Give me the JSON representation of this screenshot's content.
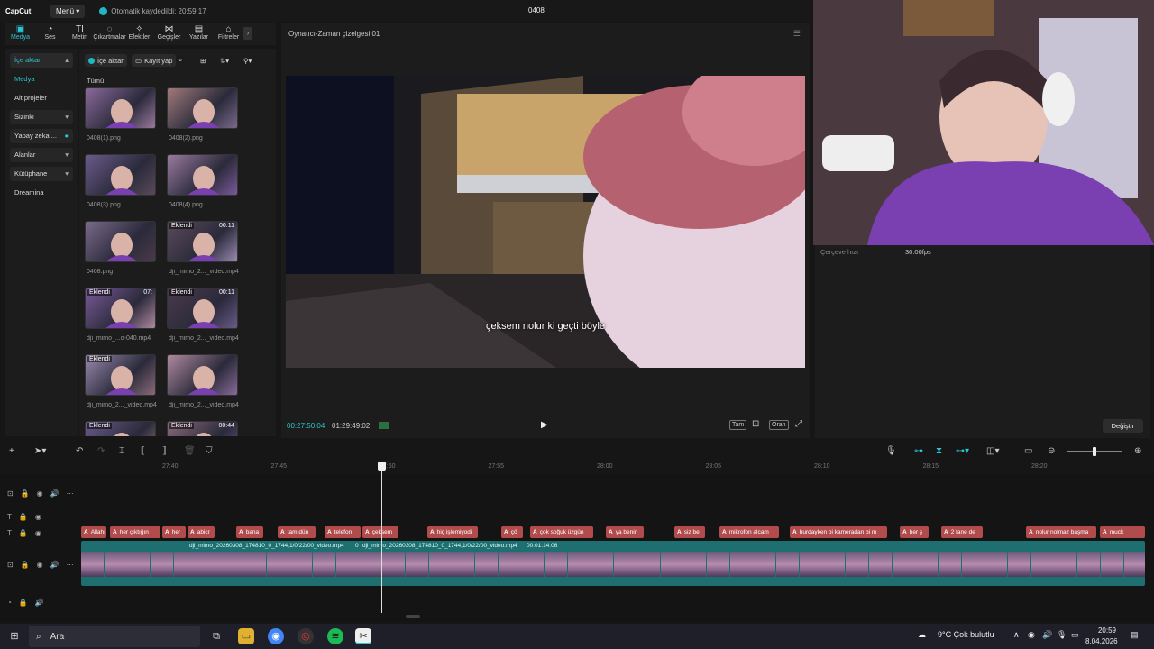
{
  "app": {
    "logo": "CapCut",
    "menu": "Menü",
    "autosave": "Otomatik kaydedildi: 20:59:17",
    "project": "0408"
  },
  "tabs": [
    {
      "label": "Medya",
      "icon": "media-icon",
      "glyph": "▣"
    },
    {
      "label": "Ses",
      "icon": "audio-icon",
      "glyph": "◔"
    },
    {
      "label": "Metin",
      "icon": "text-icon",
      "glyph": "TI"
    },
    {
      "label": "Çıkartmalar",
      "icon": "sticker-icon",
      "glyph": "◌"
    },
    {
      "label": "Efektler",
      "icon": "effects-icon",
      "glyph": "✧"
    },
    {
      "label": "Geçişler",
      "icon": "transitions-icon",
      "glyph": "⋈"
    },
    {
      "label": "Yazılar",
      "icon": "captions-icon",
      "glyph": "▤"
    },
    {
      "label": "Filtreler",
      "icon": "filters-icon",
      "glyph": "⌂"
    }
  ],
  "nav": [
    {
      "label": "İçe aktar",
      "arrow": "▴"
    },
    {
      "label": "Medya",
      "arrow": ""
    },
    {
      "label": "Alt projeler",
      "arrow": ""
    },
    {
      "label": "Sizinki",
      "arrow": "▾"
    },
    {
      "label": "Yapay zeka ...",
      "arrow": "●"
    },
    {
      "label": "Alanlar",
      "arrow": "▾"
    },
    {
      "label": "Kütüphane",
      "arrow": "▾"
    },
    {
      "label": "Dreamina",
      "arrow": ""
    }
  ],
  "media": {
    "import": "İçe aktar",
    "record": "Kayıt yap",
    "all": "Tümü",
    "items": [
      {
        "name": "0408(1).png",
        "badge": "",
        "dur": ""
      },
      {
        "name": "0408(2).png",
        "badge": "",
        "dur": ""
      },
      {
        "name": "0408(3).png",
        "badge": "",
        "dur": ""
      },
      {
        "name": "0408(4).png",
        "badge": "",
        "dur": ""
      },
      {
        "name": "0408.png",
        "badge": "",
        "dur": ""
      },
      {
        "name": "dji_mimo_2..._video.mp4",
        "badge": "Eklendi",
        "dur": "00:11"
      },
      {
        "name": "dji_mimo_...o-040.mp4",
        "badge": "Eklendi",
        "dur": "07:"
      },
      {
        "name": "dji_mimo_2..._video.mp4",
        "badge": "Eklendi",
        "dur": "00:11"
      },
      {
        "name": "dji_mimo_2..._video.mp4",
        "badge": "Eklendi",
        "dur": ""
      },
      {
        "name": "dji_mimo_2..._video.mp4",
        "badge": "",
        "dur": ""
      },
      {
        "name": "",
        "badge": "Eklendi",
        "dur": ""
      },
      {
        "name": "",
        "badge": "Eklendi",
        "dur": "00:44"
      }
    ]
  },
  "player": {
    "title": "Oynatıcı-Zaman çizelgesi 01",
    "subtitle": "çeksem nolur ki geçti böyle",
    "current": "00:27:50:04",
    "total": "01:29:49:02",
    "full": "Tam",
    "ratio": "Oran"
  },
  "props": {
    "label": "Çerçeve hızı",
    "value": "30.00fps",
    "change": "Değiştir"
  },
  "ruler": [
    "27:40",
    "27:45",
    "27:50",
    "27:55",
    "28:00",
    "28:05",
    "28:10",
    "28:15",
    "28:20"
  ],
  "text_clips": [
    {
      "text": "Allahı"
    },
    {
      "text": "her çıktığın"
    },
    {
      "text": "her"
    },
    {
      "text": "abicr"
    },
    {
      "text": "bana"
    },
    {
      "text": "tam dün"
    },
    {
      "text": "telefon"
    },
    {
      "text": "çeksem"
    },
    {
      "text": "hiç işlemiyodi"
    },
    {
      "text": "çö"
    },
    {
      "text": "çok soğuk üzgün"
    },
    {
      "text": "ya benin"
    },
    {
      "text": "siz be"
    },
    {
      "text": "mikrofon alcam"
    },
    {
      "text": "burdayken bi kameradan bi m"
    },
    {
      "text": "her ş"
    },
    {
      "text": "2 tane de"
    },
    {
      "text": "nolur nolmaz başma"
    },
    {
      "text": "muck"
    }
  ],
  "video_clips": [
    {
      "text": "dji_mimo_20260308_174810_0_1744,1/0/22/00_video.mp4"
    },
    {
      "text": "0"
    },
    {
      "text": "dji_mimo_20260308_174810_0_1744,1/0/22/00_video.mp4"
    },
    {
      "text": "00:01:14:06"
    }
  ],
  "taskbar": {
    "search": "Ara",
    "weather": "9°C  Çok bulutlu",
    "time": "20:59",
    "date": "8.04.2026"
  },
  "colors": {
    "accent": "#2ec5d3",
    "text_clip": "#b24c4c",
    "video_track": "#1d6f70"
  }
}
